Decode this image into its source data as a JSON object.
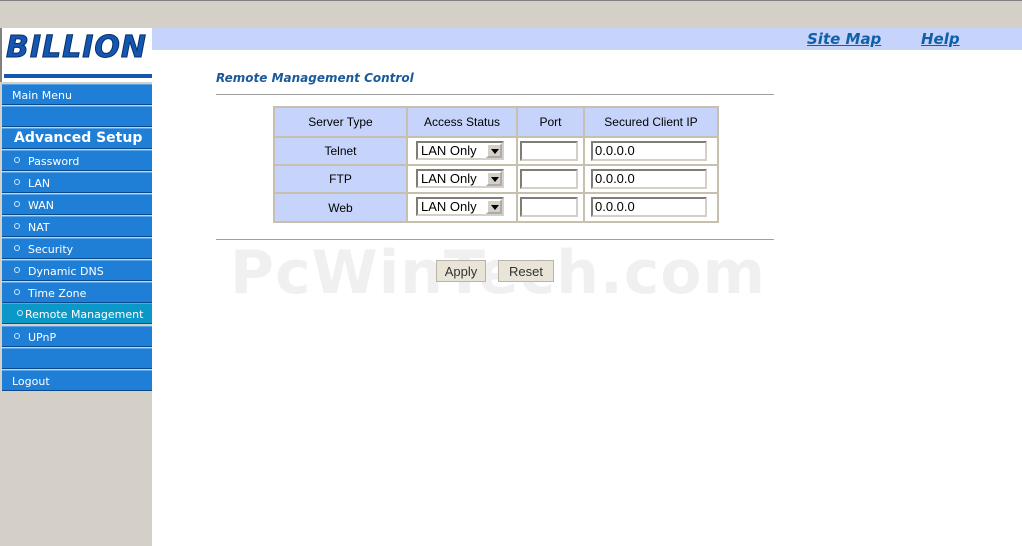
{
  "brand": {
    "logo_text": "BILLION"
  },
  "topbar": {
    "site_map": "Site Map",
    "help": "Help"
  },
  "sidebar": {
    "main_menu": "Main Menu",
    "advanced_setup": "Advanced Setup",
    "items": [
      "Password",
      "LAN",
      "WAN",
      "NAT",
      "Security",
      "Dynamic DNS",
      "Time Zone",
      "Remote Management",
      "UPnP"
    ],
    "active": "Remote Management",
    "logout": "Logout"
  },
  "page": {
    "title": "Remote Management Control",
    "table": {
      "headers": [
        "Server Type",
        "Access Status",
        "Port",
        "Secured Client IP"
      ],
      "rows": [
        {
          "server_type": "Telnet",
          "access_status": "LAN Only",
          "port": "",
          "secured_ip": "0.0.0.0"
        },
        {
          "server_type": "FTP",
          "access_status": "LAN Only",
          "port": "",
          "secured_ip": "0.0.0.0"
        },
        {
          "server_type": "Web",
          "access_status": "LAN Only",
          "port": "",
          "secured_ip": "0.0.0.0"
        }
      ]
    },
    "apply_label": "Apply",
    "reset_label": "Reset",
    "watermark": "PcWinTech.com"
  },
  "colors": {
    "nav_blue": "#1f7fd6",
    "nav_active": "#0b98c9",
    "header_blue": "#c6d4fb",
    "link_blue": "#1060a8"
  }
}
